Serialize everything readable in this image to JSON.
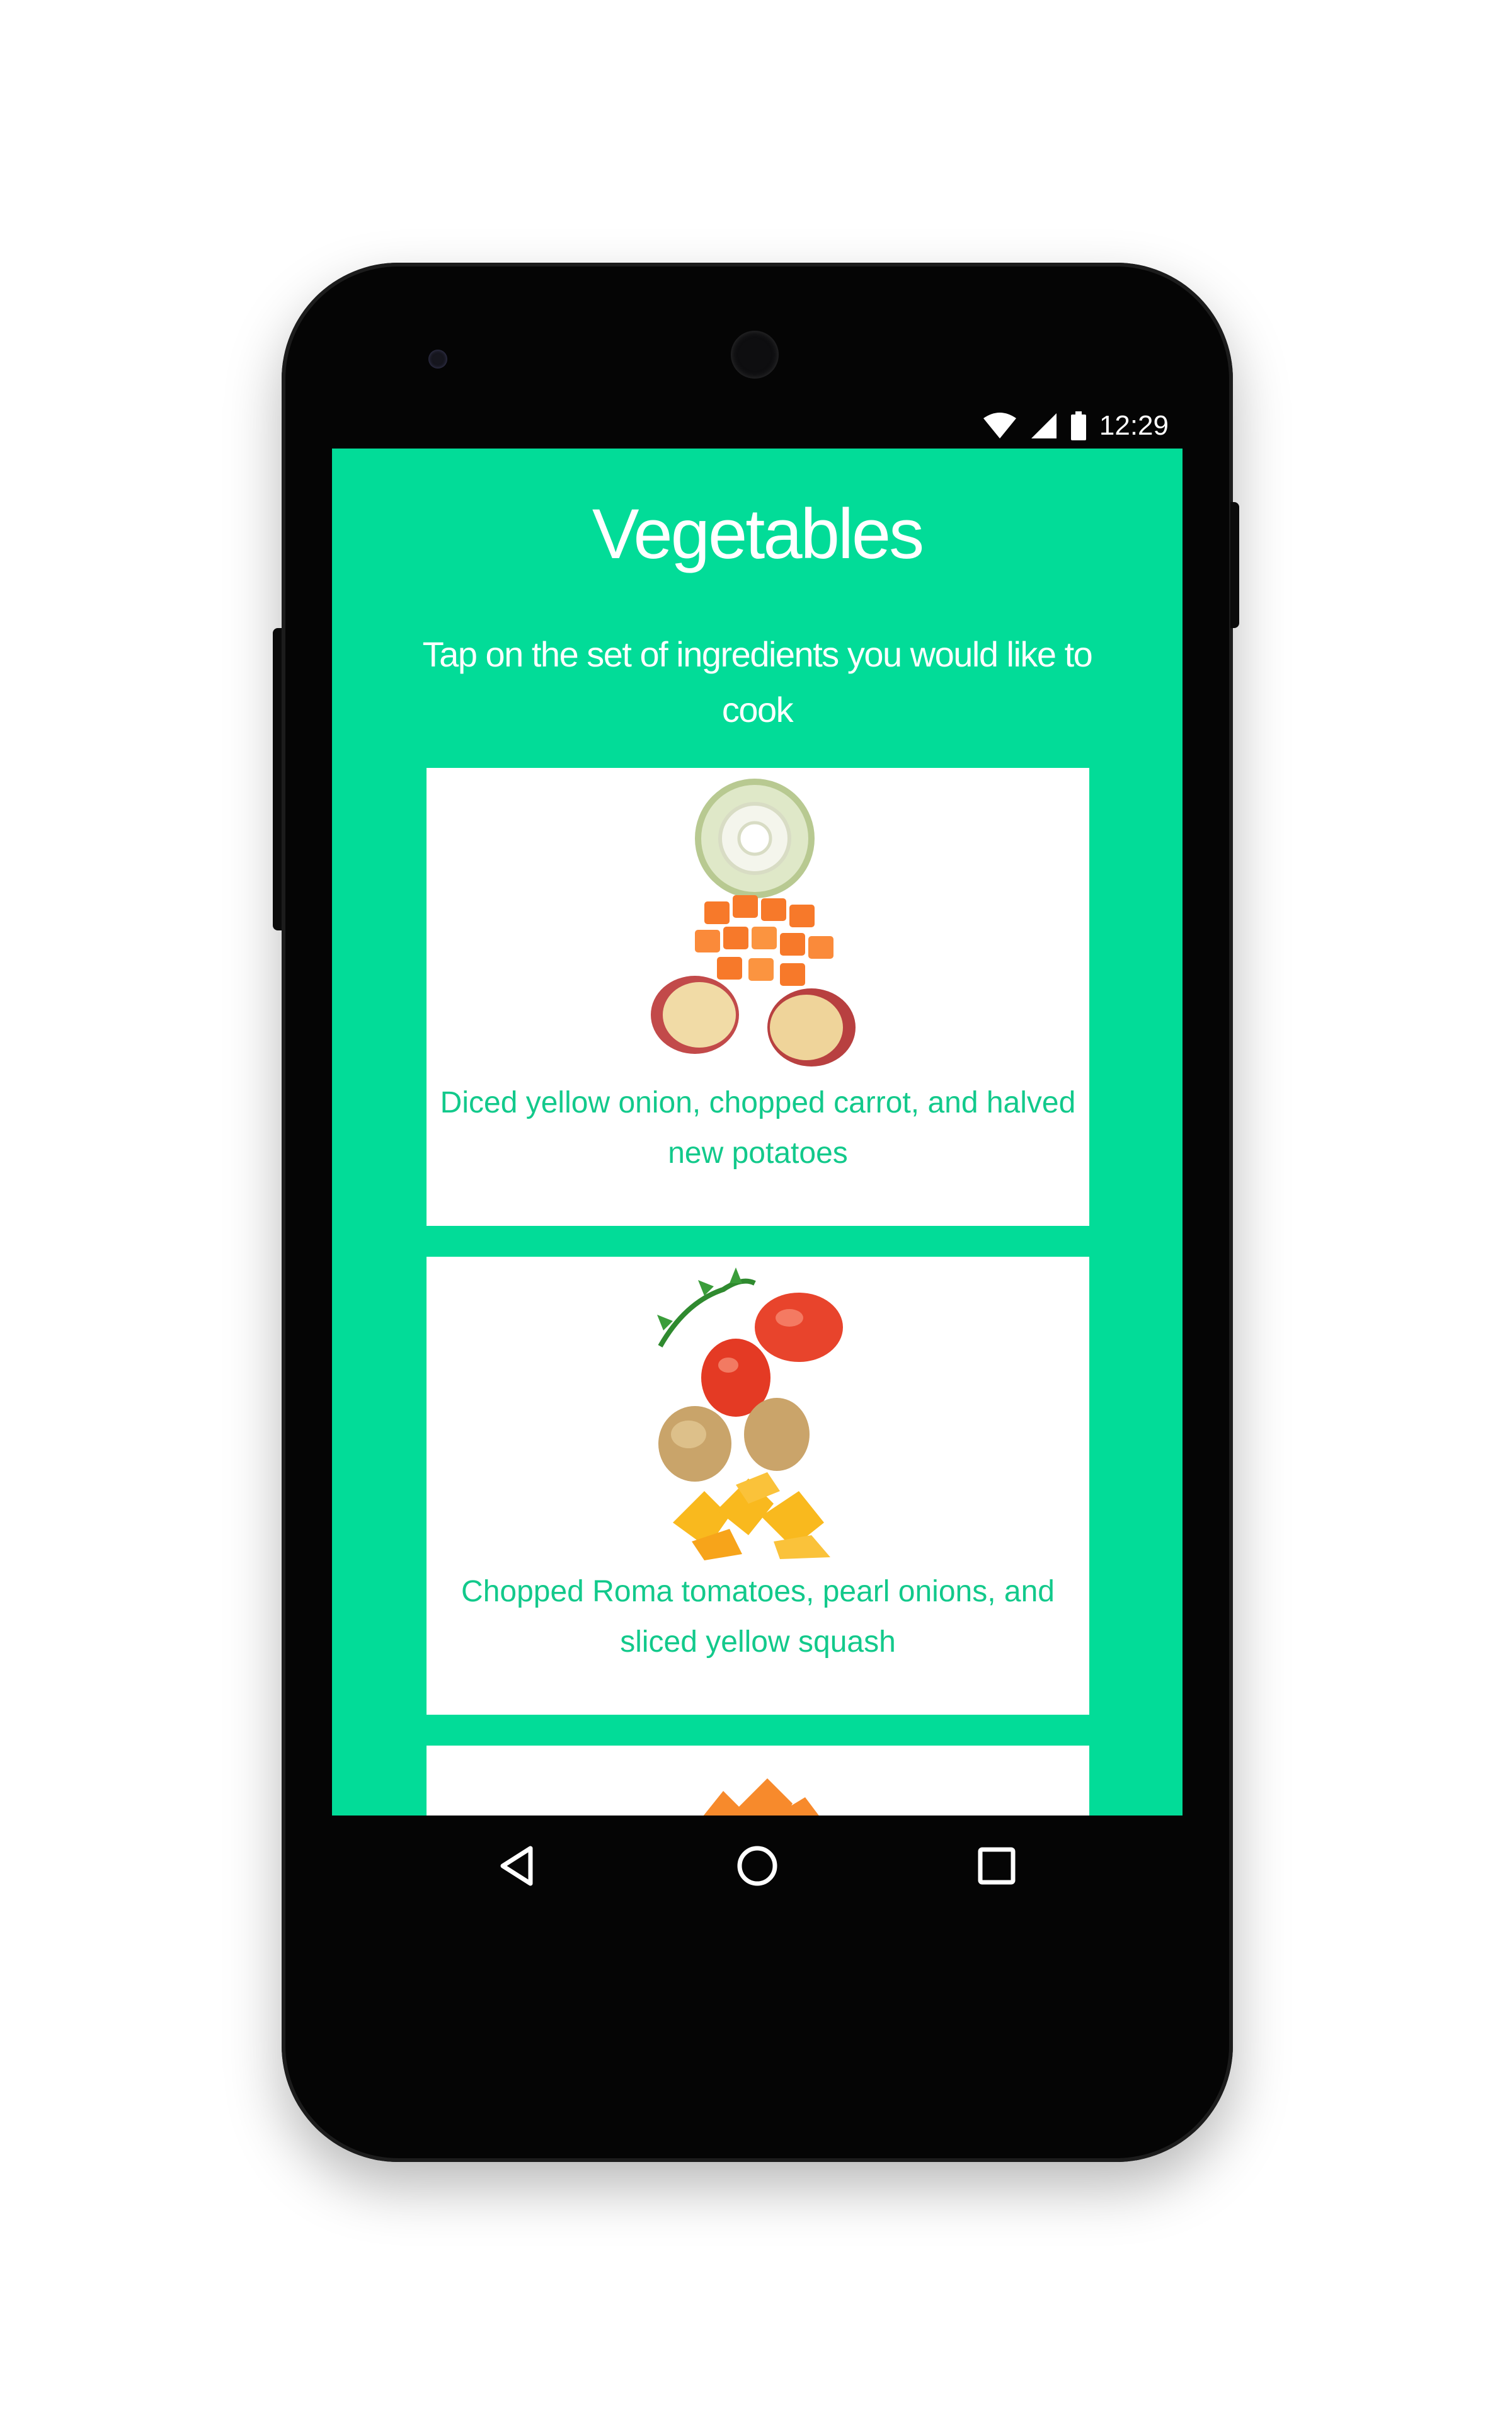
{
  "status_bar": {
    "time": "12:29",
    "icons": [
      "wifi-icon",
      "signal-icon",
      "battery-icon"
    ]
  },
  "screen": {
    "title": "Vegetables",
    "subtitle": "Tap on the set of ingredients you would like to cook",
    "cards": [
      {
        "label": "Diced yellow onion, chopped carrot, and halved new potatoes",
        "image": "onion-carrot-potato-image"
      },
      {
        "label": "Chopped Roma tomatoes, pearl onions, and sliced yellow squash",
        "image": "tomato-onion-squash-image"
      },
      {
        "label": "",
        "image": "carrot-image"
      }
    ]
  },
  "nav_bar": {
    "icons": [
      "back-icon",
      "home-icon",
      "recent-apps-icon"
    ]
  },
  "colors": {
    "accent": "#02dc98",
    "card_text": "#12c98b",
    "card_bg": "#ffffff"
  }
}
